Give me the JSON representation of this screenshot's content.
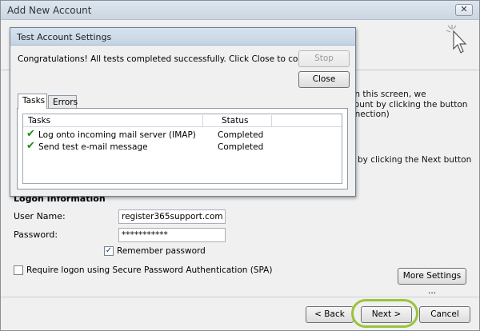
{
  "outer": {
    "title": "Add New Account",
    "close_glyph": "✕",
    "description_lines": [
      "on this screen, we",
      "count by clicking the button",
      "nnection)",
      "by clicking the Next button"
    ],
    "logon_section_title": "Logon Information",
    "user_name_label": "User Name:",
    "user_name_value": "register365support.com",
    "password_label": "Password:",
    "password_value": "***********",
    "remember_label": "Remember password",
    "remember_checked": "✓",
    "spa_label": "Require logon using Secure Password Authentication (SPA)",
    "more_settings_label": "More Settings ...",
    "back_label": "< Back",
    "next_label": "Next >",
    "cancel_label": "Cancel",
    "highlight_color": "#9ac43a"
  },
  "dialog": {
    "title": "Test Account Settings",
    "message": "Congratulations! All tests completed successfully. Click Close to continue.",
    "stop_label": "Stop",
    "close_label": "Close",
    "tabs": [
      {
        "label": "Tasks"
      },
      {
        "label": "Errors"
      }
    ],
    "columns": {
      "task": "Tasks",
      "status": "Status"
    },
    "rows": [
      {
        "task": "Log onto incoming mail server (IMAP)",
        "status": "Completed"
      },
      {
        "task": "Send test e-mail message",
        "status": "Completed"
      }
    ],
    "check_icon_color": "#1b8a1b"
  }
}
